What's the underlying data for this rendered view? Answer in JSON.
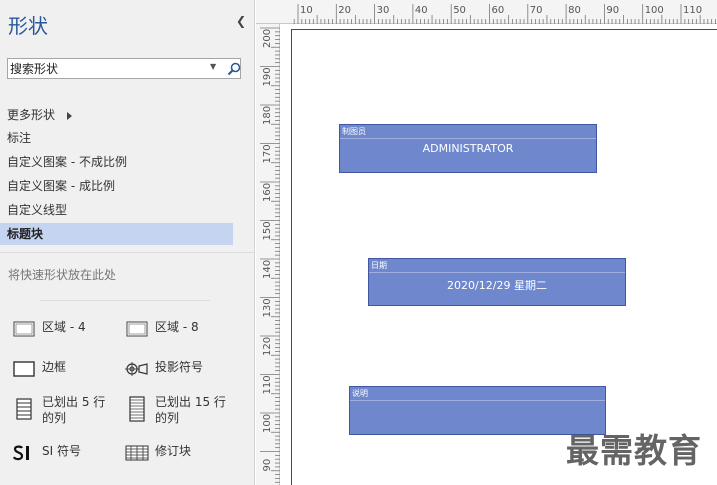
{
  "pane": {
    "title": "形状",
    "collapse_icon": "chevron-left-icon",
    "search": {
      "value": "搜索形状",
      "placeholder": ""
    },
    "menu": [
      {
        "label": "更多形状",
        "has_submenu": true
      },
      {
        "label": "标注"
      },
      {
        "label": "自定义图案 - 不成比例"
      },
      {
        "label": "自定义图案 - 成比例"
      },
      {
        "label": "自定义线型"
      },
      {
        "label": "标题块",
        "selected": true
      }
    ],
    "hint": "将快速形状放在此处",
    "shapes": [
      {
        "label": "区域 - 4",
        "icon": "region-icon"
      },
      {
        "label": "区域 - 8",
        "icon": "region-icon"
      },
      {
        "label": "边框",
        "icon": "border-icon"
      },
      {
        "label": "投影符号",
        "icon": "projection-symbol-icon"
      },
      {
        "label": "已划出 5 行\n的列",
        "icon": "table-column-icon"
      },
      {
        "label": "已划出 15 行\n的列",
        "icon": "table-column-icon"
      },
      {
        "label": "SI 符号",
        "icon": "si-symbol-icon"
      },
      {
        "label": "修订块",
        "icon": "revision-block-icon"
      }
    ]
  },
  "rulers": {
    "horizontal": [
      "10",
      "20",
      "30",
      "40",
      "50",
      "60",
      "70",
      "80",
      "90",
      "100",
      "110",
      "1"
    ],
    "vertical": [
      "200",
      "190",
      "180",
      "170",
      "160",
      "150",
      "140",
      "130",
      "120",
      "110",
      "100",
      "90"
    ]
  },
  "canvas": {
    "blocks": [
      {
        "caption": "制图员",
        "value": "ADMINISTRATOR"
      },
      {
        "caption": "日期",
        "value": "2020/12/29 星期二"
      },
      {
        "caption": "说明",
        "value": ""
      }
    ],
    "block_fill": "#6f87cc"
  },
  "watermark": "最需教育"
}
